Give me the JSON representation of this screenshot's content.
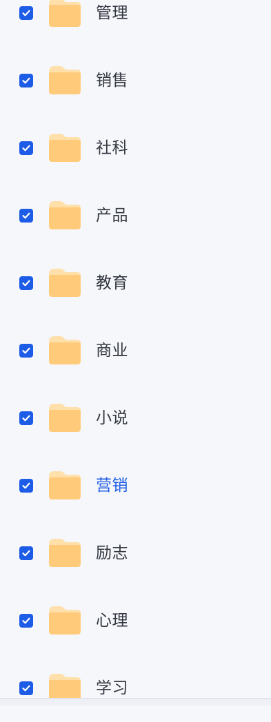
{
  "colors": {
    "background": "#f6f7fb",
    "checkbox": "#1d5ce6",
    "folder": "#ffcb7a",
    "folder_tab": "#ffe0ab",
    "text": "#333740",
    "active_text": "#1d5ce6"
  },
  "folders": [
    {
      "label": "管理",
      "checked": true,
      "active": false,
      "icon": "folder-icon"
    },
    {
      "label": "销售",
      "checked": true,
      "active": false,
      "icon": "folder-icon"
    },
    {
      "label": "社科",
      "checked": true,
      "active": false,
      "icon": "folder-icon"
    },
    {
      "label": "产品",
      "checked": true,
      "active": false,
      "icon": "folder-icon"
    },
    {
      "label": "教育",
      "checked": true,
      "active": false,
      "icon": "folder-icon"
    },
    {
      "label": "商业",
      "checked": true,
      "active": false,
      "icon": "folder-icon"
    },
    {
      "label": "小说",
      "checked": true,
      "active": false,
      "icon": "folder-icon"
    },
    {
      "label": "营销",
      "checked": true,
      "active": true,
      "icon": "folder-icon"
    },
    {
      "label": "励志",
      "checked": true,
      "active": false,
      "icon": "folder-icon"
    },
    {
      "label": "心理",
      "checked": true,
      "active": false,
      "icon": "folder-icon"
    },
    {
      "label": "学习",
      "checked": true,
      "active": false,
      "icon": "folder-icon"
    }
  ]
}
